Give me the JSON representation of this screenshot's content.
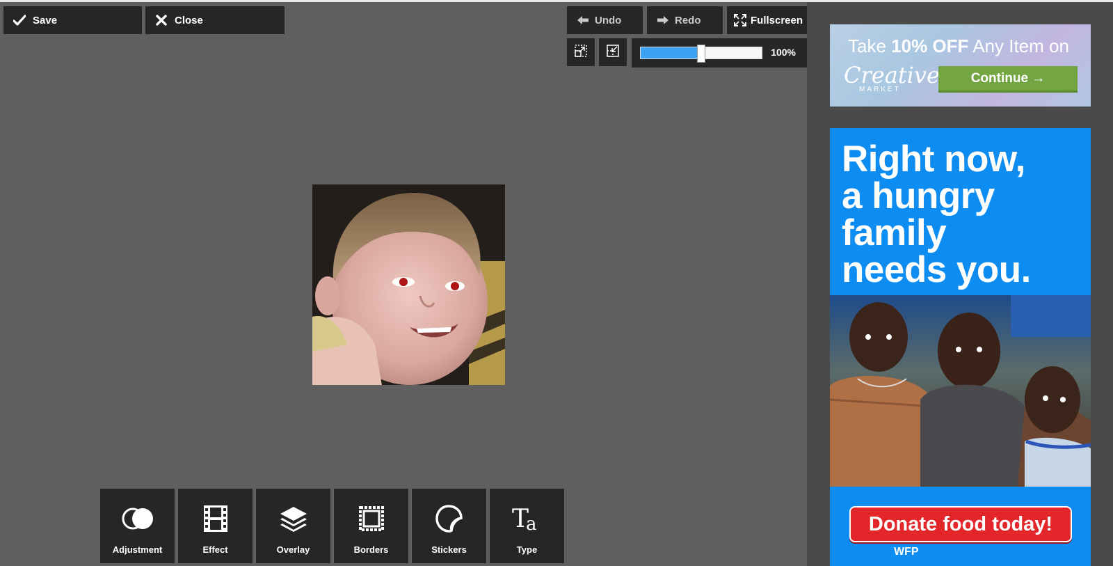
{
  "toolbar": {
    "save_label": "Save",
    "close_label": "Close",
    "undo_label": "Undo",
    "redo_label": "Redo",
    "fullscreen_label": "Fullscreen"
  },
  "zoom": {
    "value_label": "100%",
    "slider_fraction": 0.5
  },
  "tools": [
    {
      "label": "Adjustment",
      "icon": "adjustment-icon"
    },
    {
      "label": "Effect",
      "icon": "film-icon"
    },
    {
      "label": "Overlay",
      "icon": "layers-icon"
    },
    {
      "label": "Borders",
      "icon": "border-frame-icon"
    },
    {
      "label": "Stickers",
      "icon": "sticker-icon"
    },
    {
      "label": "Type",
      "icon": "type-icon"
    }
  ],
  "ads": {
    "creative_market": {
      "text_pre": "Take ",
      "text_bold": "10% OFF",
      "text_post": " Any Item on",
      "brand": "Creative",
      "brand_sub": "MARKET",
      "cta": "Continue →"
    },
    "wfp": {
      "headline": [
        "Right now,",
        "a hungry",
        "family",
        "needs you."
      ],
      "donate_label": "Donate food today!",
      "footer": "WFP"
    }
  },
  "colors": {
    "editor_bg": "#5f5f5f",
    "toolbar_bg": "#262626",
    "accent_blue": "#3ea2f2",
    "ad_green": "#73a542",
    "ad_blue": "#0d8cf1",
    "donate_red": "#e3262a"
  }
}
